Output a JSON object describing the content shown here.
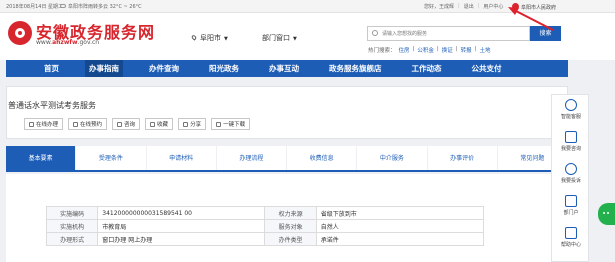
{
  "topbar": {
    "date": "2018年08月14日  星期二",
    "weather": "阜阳市阵雨转多云 32°C ~ 26°C",
    "links": [
      "您好，王成辉",
      "退出",
      "用户中心"
    ],
    "gov_name": "阜阳市人民政府"
  },
  "header": {
    "title": "安徽政务服务网",
    "url_prefix": "www.",
    "url_domain": "ahzwfw",
    "url_suffix": ".gov.cn",
    "city": "阜阳市",
    "window": "部门窗口",
    "search_placeholder": "请输入您想找的服务",
    "search_button": "搜索",
    "hot_label": "热门搜索：",
    "hot_links": [
      "住房",
      "公积金",
      "换证",
      "转报",
      "土地"
    ]
  },
  "nav": {
    "items": [
      "首页",
      "办事指南",
      "办件查询",
      "阳光政务",
      "办事互动",
      "政务服务旗舰店",
      "工作动态",
      "公共支付"
    ],
    "active_index": 1
  },
  "service": {
    "title": "普通话水平测试考务服务",
    "actions": [
      "在线办理",
      "在线预约",
      "咨询",
      "收藏",
      "分享",
      "一键下载"
    ]
  },
  "tabs": {
    "items": [
      "基本要素",
      "受理条件",
      "申请材料",
      "办理流程",
      "收费信息",
      "中介服务",
      "办事评价",
      "常见问题"
    ],
    "active_index": 0
  },
  "info": {
    "rows": [
      {
        "k1": "实施编码",
        "v1": "341200000000031589541 00",
        "k2": "权力来源",
        "v2": "省级下放到市"
      },
      {
        "k1": "实施机构",
        "v1": "市教育局",
        "k2": "服务对象",
        "v2": "自然人"
      },
      {
        "k1": "办理形式",
        "v1": "窗口办理 网上办理",
        "k2": "办件类型",
        "v2": "承诺件"
      }
    ]
  },
  "sidebar": {
    "items": [
      "智能客服",
      "我要咨询",
      "我要投诉",
      "部门户",
      "帮助中心"
    ]
  },
  "colors": {
    "brand_red": "#d7262e",
    "brand_blue": "#1d5db6"
  }
}
